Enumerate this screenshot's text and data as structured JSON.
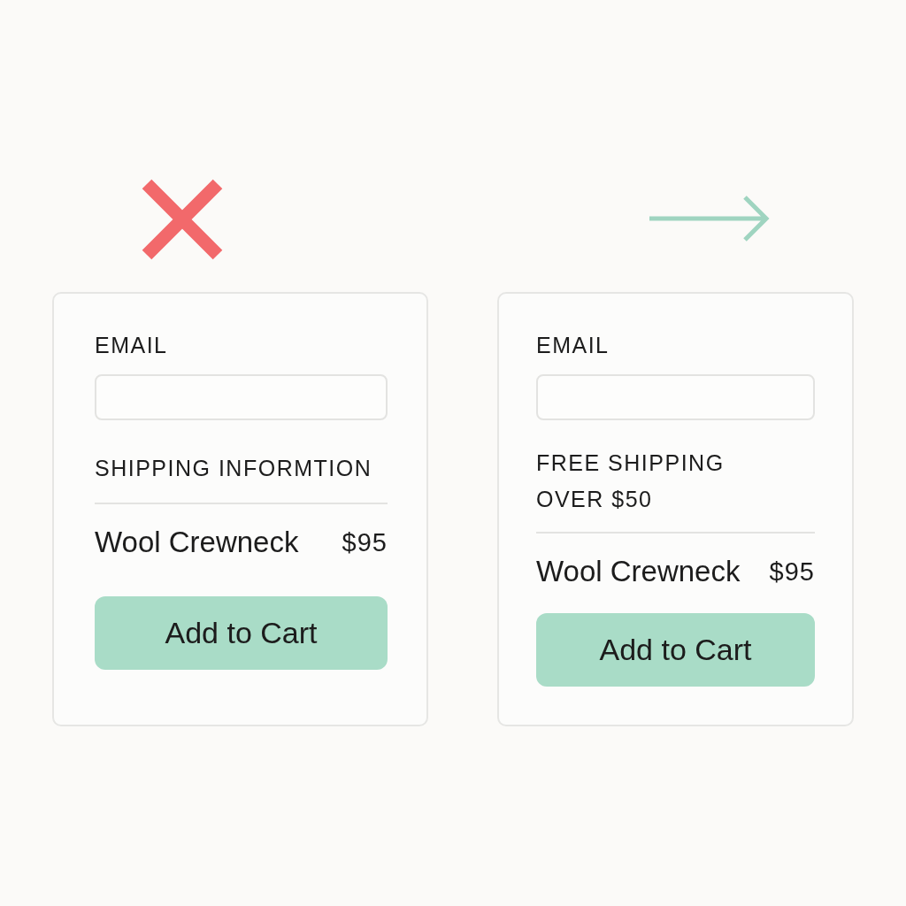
{
  "cards": [
    {
      "mark": {
        "kind": "cross"
      },
      "email_label": "EMAIL",
      "notice": "SHIPPING INFORMTION",
      "item": {
        "name": "Wool Crewneck",
        "price": "$95"
      },
      "button": "Add to Cart"
    },
    {
      "mark": {
        "kind": "arrow"
      },
      "email_label": "EMAIL",
      "notice": "FREE SHIPPING\nOVER $50",
      "item": {
        "name": "Wool Crewneck",
        "price": "$95"
      },
      "button": "Add to Cart"
    }
  ]
}
